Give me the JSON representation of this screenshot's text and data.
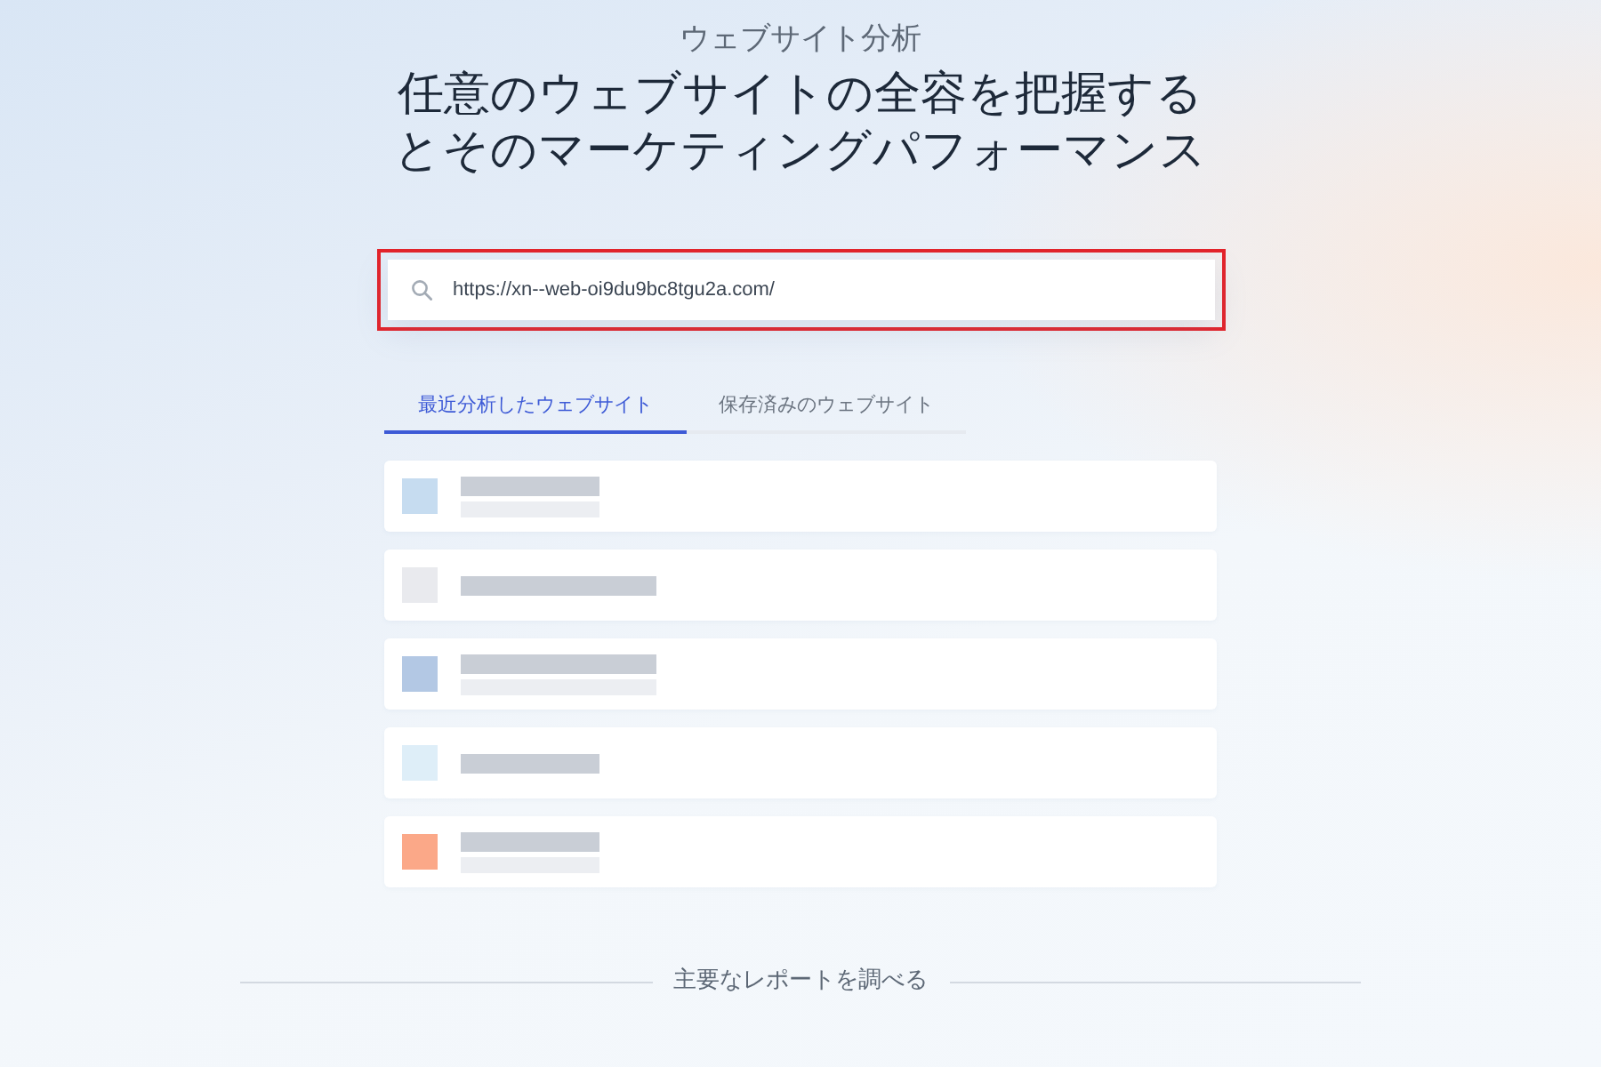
{
  "header": {
    "eyebrow": "ウェブサイト分析",
    "title_lines": [
      "任意のウェブサイトの全容を把握する",
      "とそのマーケティングパフォーマンス"
    ]
  },
  "search": {
    "value": "https://xn--web-oi9du9bc8tgu2a.com/",
    "highlighted": true
  },
  "tabs": [
    {
      "label": "最近分析したウェブサイト",
      "selected": true
    },
    {
      "label": "保存済みのウェブサイト",
      "selected": false
    }
  ],
  "recent_sites": [
    {
      "kind": "short-pair",
      "color": "#c6dcf0"
    },
    {
      "kind": "long-single",
      "color": "#e9eaee"
    },
    {
      "kind": "long-pair",
      "color": "#b3c8e4"
    },
    {
      "kind": "short-single",
      "color": "#deeef8"
    },
    {
      "kind": "short-pair",
      "color": "#fba888"
    }
  ],
  "section_divider": {
    "label": "主要なレポートを調べる"
  }
}
